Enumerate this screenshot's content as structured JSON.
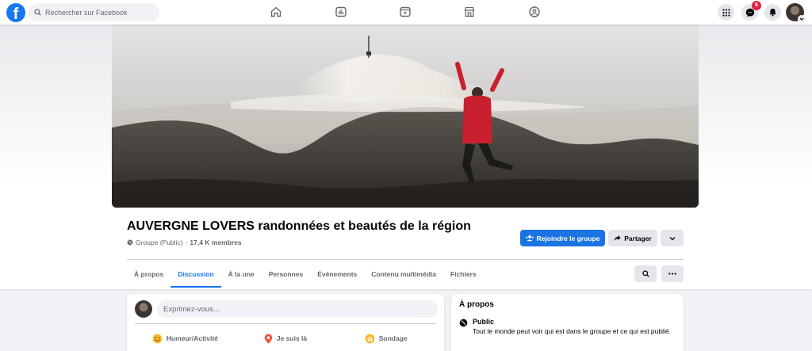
{
  "topbar": {
    "logo": "f",
    "search_placeholder": "Rechercher sur Facebook",
    "nav_icons": [
      "home-icon",
      "watch-icon",
      "reels-icon",
      "marketplace-icon",
      "groups-icon"
    ],
    "right_icons": [
      "menu-grid-icon",
      "messenger-icon",
      "bell-icon"
    ],
    "messenger_badge": "6"
  },
  "group": {
    "title": "AUVERGNE LOVERS randonnées et beautés de la région",
    "privacy": "Groupe (Public)",
    "separator": "·",
    "members": "17,4 K membres",
    "join_label": "Rejoindre le groupe",
    "share_label": "Partager"
  },
  "tabs": [
    "À propos",
    "Discussion",
    "À la une",
    "Personnes",
    "Événements",
    "Contenu multimédia",
    "Fichiers"
  ],
  "active_tab": "Discussion",
  "composer": {
    "placeholder": "Exprimez-vous...",
    "actions": [
      {
        "label": "Humeur/Activité",
        "icon": "smiley-icon",
        "color": "#f7b928"
      },
      {
        "label": "Je suis là",
        "icon": "location-pin-icon",
        "color": "#f5533d"
      },
      {
        "label": "Sondage",
        "icon": "poll-icon",
        "color": "#f7b928"
      }
    ]
  },
  "about": {
    "title": "À propos",
    "privacy_title": "Public",
    "privacy_desc": "Tout le monde peut voir qui est dans le groupe et ce qui est publié."
  },
  "colors": {
    "accent": "#1877f2",
    "badge": "#e41e3f",
    "background": "#f0f2f5"
  }
}
